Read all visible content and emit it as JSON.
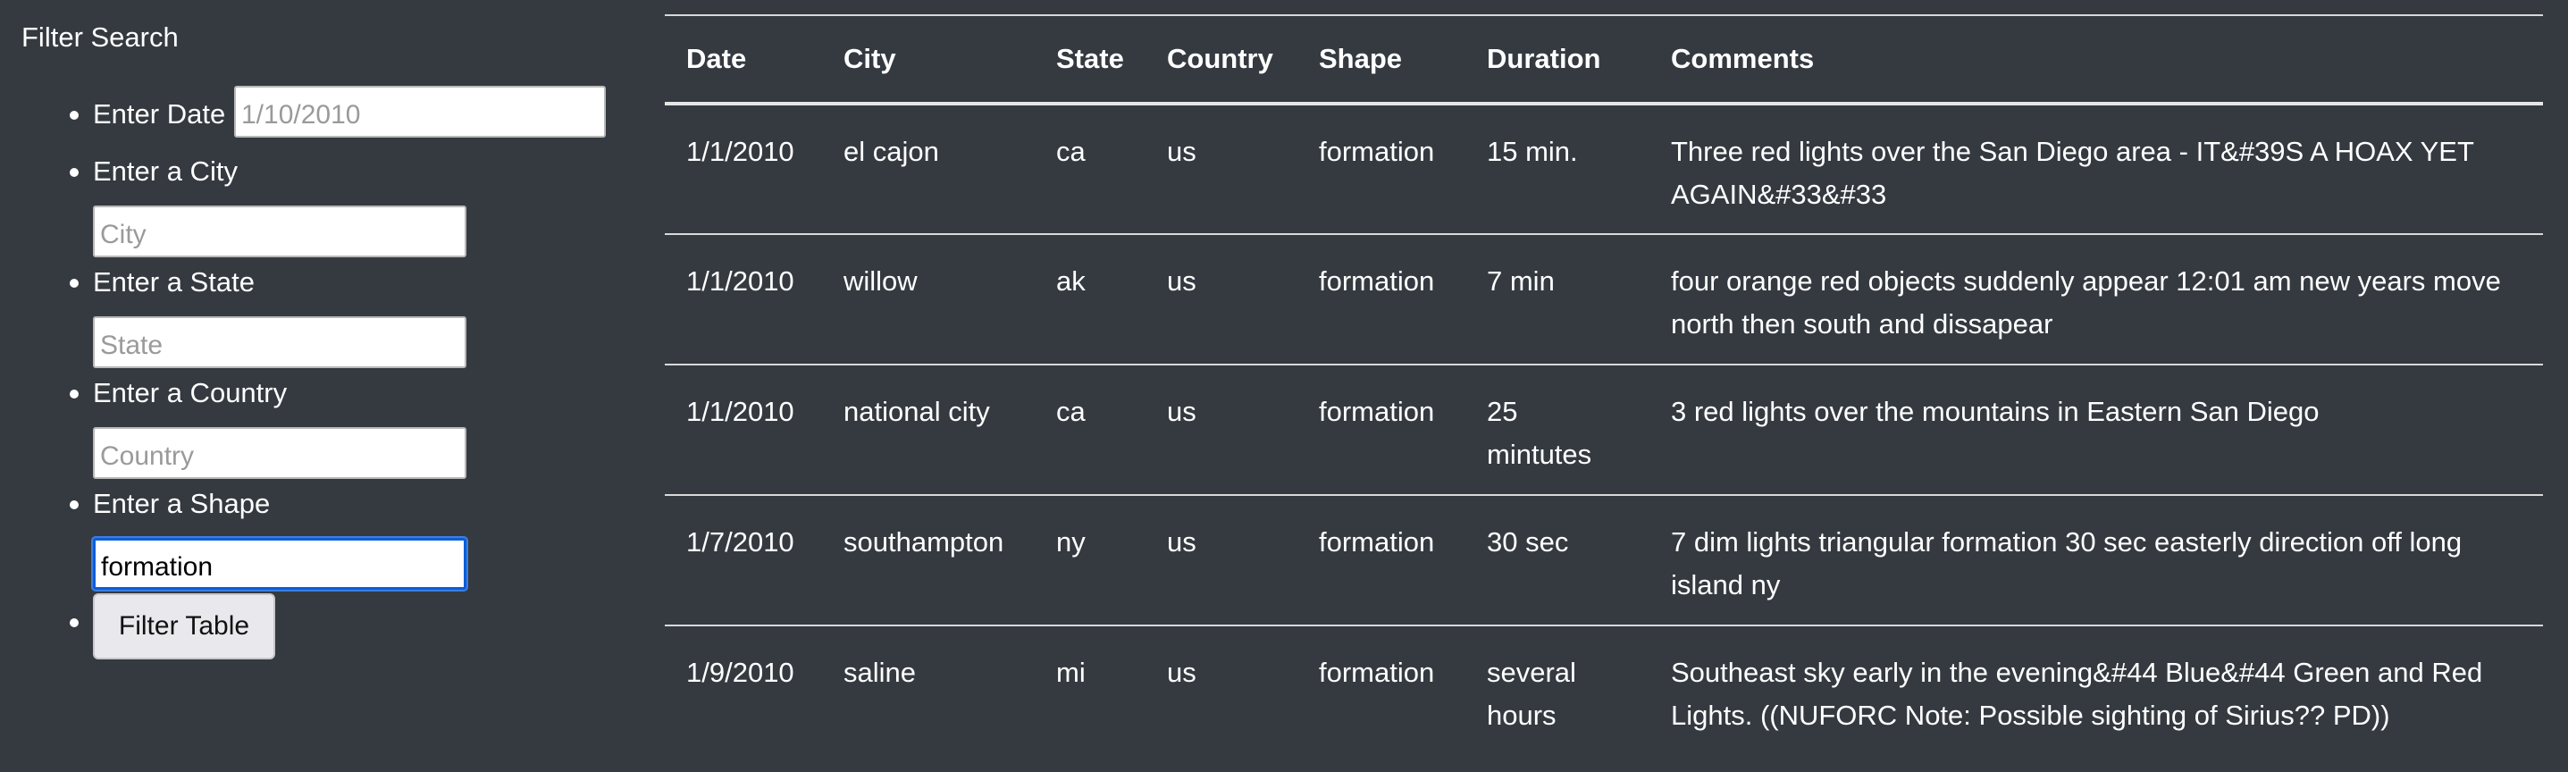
{
  "filter": {
    "title": "Filter Search",
    "date_label": "Enter Date",
    "date_placeholder": "1/10/2010",
    "city_label": "Enter a City",
    "city_placeholder": "City",
    "state_label": "Enter a State",
    "state_placeholder": "State",
    "country_label": "Enter a Country",
    "country_placeholder": "Country",
    "shape_label": "Enter a Shape",
    "shape_value": "formation",
    "button_label": "Filter Table"
  },
  "table": {
    "headers": [
      "Date",
      "City",
      "State",
      "Country",
      "Shape",
      "Duration",
      "Comments"
    ],
    "rows": [
      [
        "1/1/2010",
        "el cajon",
        "ca",
        "us",
        "formation",
        "15 min.",
        "Three red lights over the San Diego area - IT&#39S A HOAX YET AGAIN&#33&#33"
      ],
      [
        "1/1/2010",
        "willow",
        "ak",
        "us",
        "formation",
        "7 min",
        "four orange red objects suddenly appear 12:01 am new years move north then south and dissapear"
      ],
      [
        "1/1/2010",
        "national city",
        "ca",
        "us",
        "formation",
        "25 mintutes",
        "3 red lights over the mountains in Eastern San Diego"
      ],
      [
        "1/7/2010",
        "southampton",
        "ny",
        "us",
        "formation",
        "30 sec",
        "7 dim lights triangular formation 30 sec easterly direction off long island ny"
      ],
      [
        "1/9/2010",
        "saline",
        "mi",
        "us",
        "formation",
        "several hours",
        "Southeast sky early in the evening&#44 Blue&#44 Green and Red Lights. ((NUFORC Note: Possible sighting of Sirius?? PD))"
      ]
    ]
  }
}
